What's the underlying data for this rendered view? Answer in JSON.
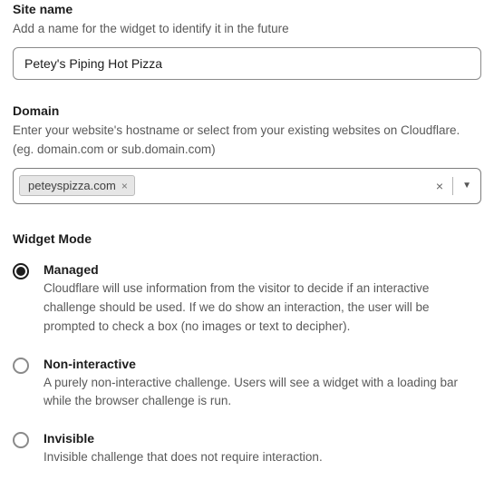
{
  "siteName": {
    "label": "Site name",
    "help": "Add a name for the widget to identify it in the future",
    "value": "Petey's Piping Hot Pizza"
  },
  "domain": {
    "label": "Domain",
    "help": "Enter your website's hostname or select from your existing websites on Cloudflare. (eg. domain.com or sub.domain.com)",
    "chip": "peteyspizza.com"
  },
  "widgetMode": {
    "heading": "Widget Mode",
    "options": [
      {
        "title": "Managed",
        "desc": "Cloudflare will use information from the visitor to decide if an interactive challenge should be used. If we do show an interaction, the user will be prompted to check a box (no images or text to decipher).",
        "selected": true
      },
      {
        "title": "Non-interactive",
        "desc": "A purely non-interactive challenge. Users will see a widget with a loading bar while the browser challenge is run.",
        "selected": false
      },
      {
        "title": "Invisible",
        "desc": "Invisible challenge that does not require interaction.",
        "selected": false
      }
    ]
  }
}
